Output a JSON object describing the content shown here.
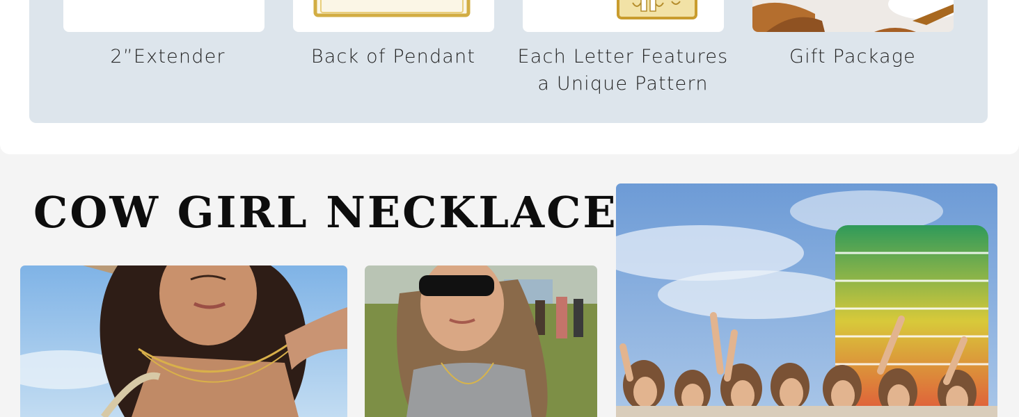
{
  "features": [
    {
      "lines": [
        "2”Extender"
      ],
      "image": "extender-chain"
    },
    {
      "lines": [
        "Back of Pendant"
      ],
      "image": "pendant-back"
    },
    {
      "lines": [
        "Each Letter Features",
        "a Unique Pattern"
      ],
      "image": "letter-pendant"
    },
    {
      "lines": [
        "Gift Package"
      ],
      "image": "gift-box"
    }
  ],
  "section_title": "COW GIRL NECKLACE",
  "photos": [
    {
      "subject": "woman-cowboy-hat"
    },
    {
      "subject": "woman-sunglasses-field"
    },
    {
      "subject": "group-festival-ferris-tower"
    }
  ],
  "colors": {
    "panel": "#dde5ec",
    "gold": "#d8b44a",
    "title": "#0d0d0d"
  }
}
